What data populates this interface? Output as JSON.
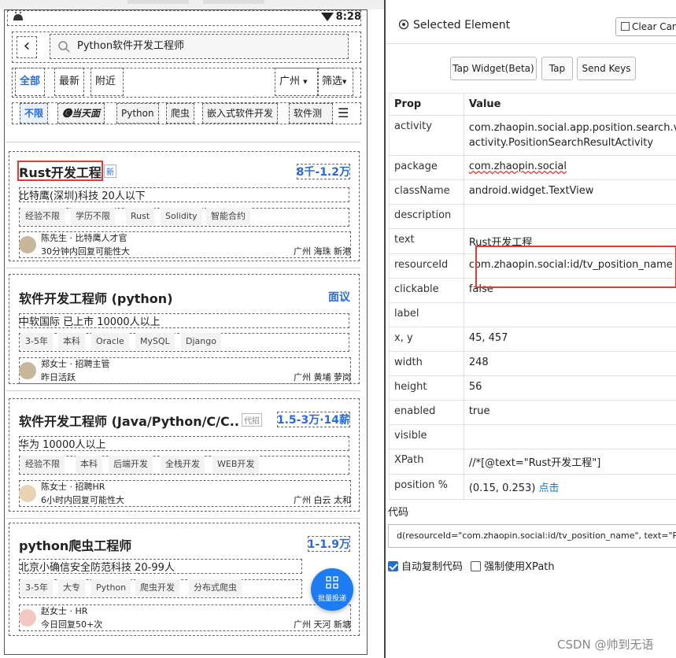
{
  "status_bar": {
    "time": "8:28"
  },
  "search": {
    "back_icon": "chevron-left-icon",
    "query": "Python软件开发工程师"
  },
  "filters": {
    "tabs": [
      "全部",
      "最新",
      "附近"
    ],
    "city": "广州",
    "filter": "筛选"
  },
  "chips": [
    "不限",
    "🅒当天面",
    "Python",
    "爬虫",
    "嵌入式软件开发",
    "软件测"
  ],
  "jobs": [
    {
      "title": "Rust开发工程",
      "badge": "新",
      "salary": "8千-1.2万",
      "company": "比特鹰(深圳)科技  20人以下",
      "tags": [
        "经验不限",
        "学历不限",
        "Rust",
        "Solidity",
        "智能合约"
      ],
      "hr_name": "陈先生 · 比特鹰人才官",
      "hr_note": "30分钟内回复可能性大",
      "location": "广州 海珠 新港"
    },
    {
      "title": "软件开发工程师 (python)",
      "badge": "",
      "salary": "面议",
      "company": "中软国际  已上市  10000人以上",
      "tags": [
        "3-5年",
        "本科",
        "Oracle",
        "MySQL",
        "Django"
      ],
      "hr_name": "郑女士 · 招聘主管",
      "hr_note": "昨日活跃",
      "location": "广州 黄埔 萝岗"
    },
    {
      "title": "软件开发工程师 (Java/Python/C/C...",
      "badge": "代招",
      "salary": "1.5-3万·14薪",
      "company": "华为  10000人以上",
      "tags": [
        "经验不限",
        "本科",
        "后端开发",
        "全栈开发",
        "WEB开发"
      ],
      "hr_name": "陈女士 · 招聘HR",
      "hr_note": "6小时内回复可能性大",
      "location": "广州 白云 太和"
    },
    {
      "title": "python爬虫工程师",
      "badge": "",
      "salary": "1-1.9万",
      "company": "北京小确信安全防范科技  20-99人",
      "tags": [
        "3-5年",
        "大专",
        "Python",
        "爬虫开发",
        "分布式爬虫"
      ],
      "hr_name": "赵女士 · HR",
      "hr_note": "今日回复50+次",
      "location": "广州 天河 新塘"
    }
  ],
  "fab": {
    "label": "批量投递"
  },
  "inspector": {
    "title": "Selected Element",
    "clear_label": "Clear Canvas",
    "buttons": [
      "Tap Widget(Beta)",
      "Tap",
      "Send Keys"
    ],
    "header": {
      "prop": "Prop",
      "value": "Value"
    },
    "props": [
      {
        "k": "activity",
        "v": "com.zhaopin.social.app.position.search.vi",
        "v2": "activity.PositionSearchResultActivity"
      },
      {
        "k": "package",
        "v": "com.zhaopin.social"
      },
      {
        "k": "className",
        "v": "android.widget.TextView"
      },
      {
        "k": "description",
        "v": ""
      },
      {
        "k": "text",
        "v": "Rust开发工程"
      },
      {
        "k": "resourceId",
        "v": "com.zhaopin.social:id/tv_position_name"
      },
      {
        "k": "clickable",
        "v": "false"
      },
      {
        "k": "label",
        "v": ""
      },
      {
        "k": "x, y",
        "v": "45, 457"
      },
      {
        "k": "width",
        "v": "248"
      },
      {
        "k": "height",
        "v": "56"
      },
      {
        "k": "enabled",
        "v": "true"
      },
      {
        "k": "visible",
        "v": ""
      },
      {
        "k": "XPath",
        "v": "//*[@text=\"Rust开发工程\"]"
      },
      {
        "k": "position %",
        "v": "(0.15, 0.253)",
        "link": "点击"
      }
    ],
    "code_label": "代码",
    "code": "d(resourceId=\"com.zhaopin.social:id/tv_position_name\", text=\"Rust开",
    "opt_copy": "自动复制代码",
    "opt_xpath": "强制使用XPath"
  },
  "watermark": "CSDN @帅到无语",
  "colors": {
    "accent": "#2b6bd6",
    "highlight": "#e53935",
    "fab": "#1e7cf2"
  }
}
